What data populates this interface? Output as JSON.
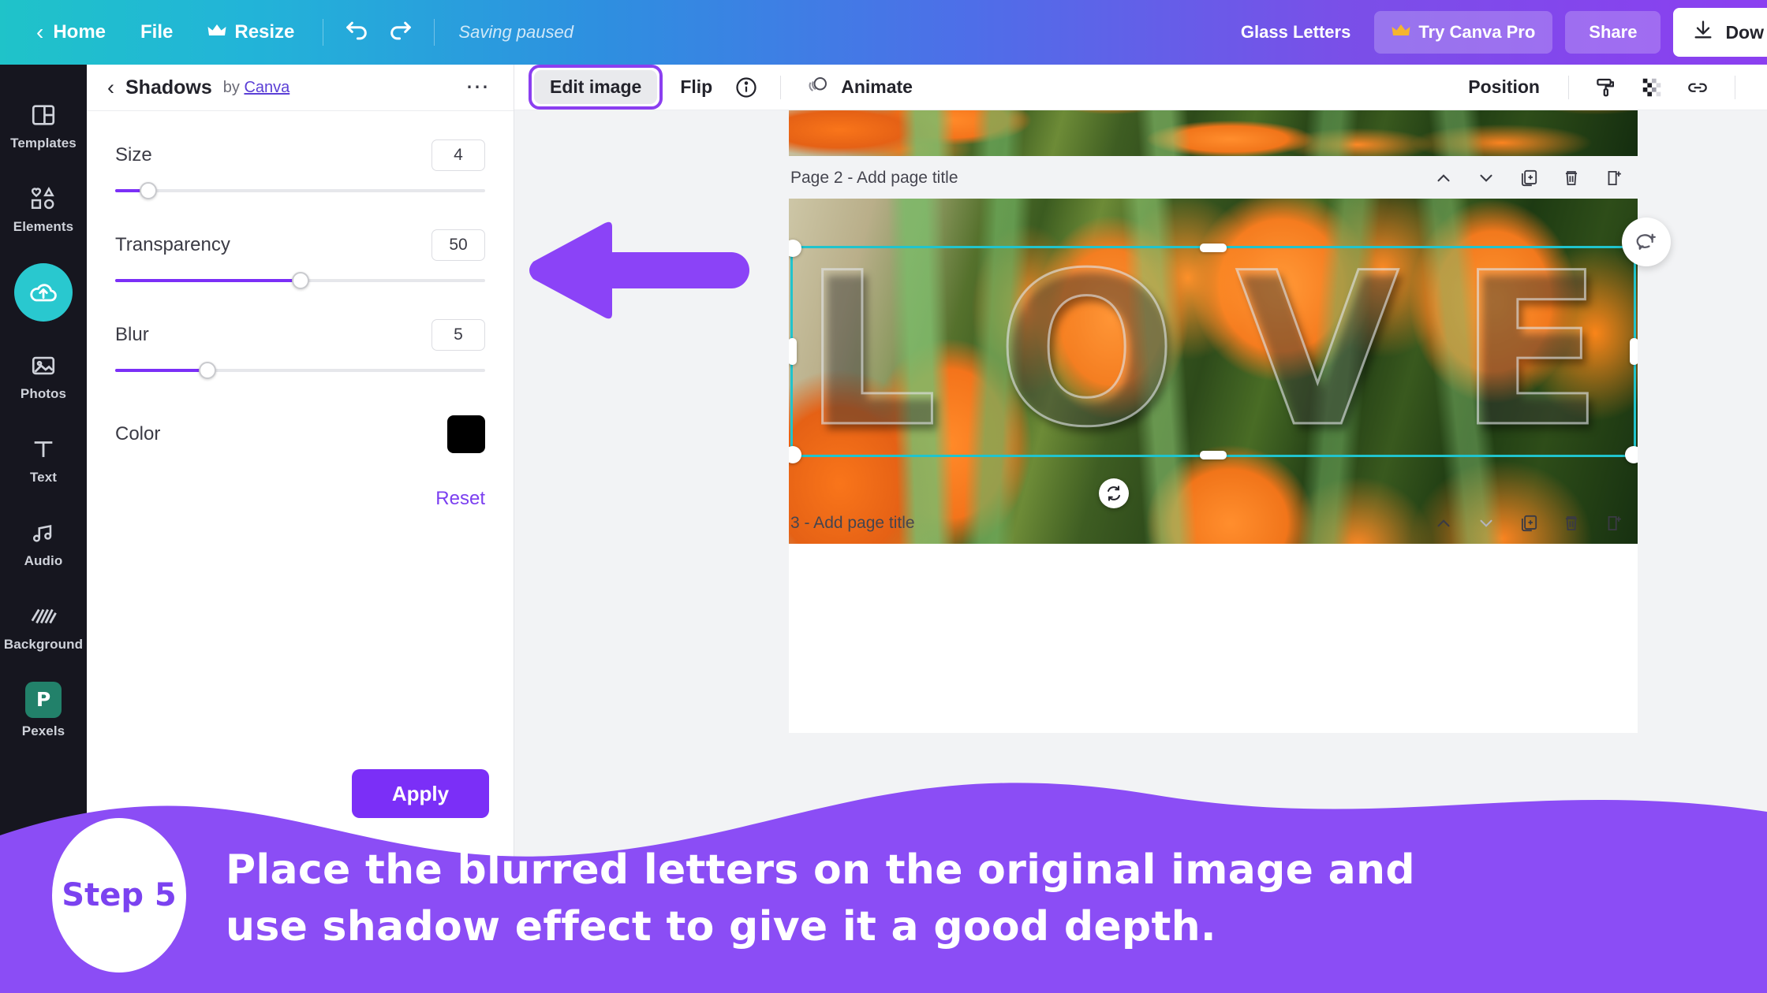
{
  "topbar": {
    "back_icon": "chevron-left-icon",
    "home": "Home",
    "file": "File",
    "resize": "Resize",
    "resize_icon": "crown-icon",
    "undo_icon": "undo-icon",
    "redo_icon": "redo-icon",
    "status": "Saving paused",
    "doc_title": "Glass Letters",
    "try_pro": "Try Canva Pro",
    "try_pro_icon": "crown-icon",
    "share": "Share",
    "download": "Dow",
    "download_icon": "download-icon",
    "gradient_start": "#1fc3c9",
    "gradient_end": "#8b3ff0"
  },
  "rail": {
    "items": [
      {
        "label": "Templates",
        "icon": "templates-icon",
        "active": false
      },
      {
        "label": "Elements",
        "icon": "elements-icon",
        "active": false
      },
      {
        "label": "",
        "icon": "uploads-cloud-icon",
        "active": true
      },
      {
        "label": "Photos",
        "icon": "photos-icon",
        "active": false
      },
      {
        "label": "Text",
        "icon": "text-icon",
        "active": false
      },
      {
        "label": "Audio",
        "icon": "audio-icon",
        "active": false
      },
      {
        "label": "Background",
        "icon": "background-icon",
        "active": false
      },
      {
        "label": "Pexels",
        "icon": "pexels-icon",
        "active": false
      }
    ],
    "active_color": "#29c8cf",
    "pexels_letter": "P"
  },
  "panel": {
    "back_icon": "chevron-left-icon",
    "title": "Shadows",
    "by_prefix": "by",
    "by_link": "Canva",
    "more_icon": "more-dots-icon",
    "controls": [
      {
        "label": "Size",
        "value": "4",
        "percent": 9
      },
      {
        "label": "Transparency",
        "value": "50",
        "percent": 50
      },
      {
        "label": "Blur",
        "value": "5",
        "percent": 25
      }
    ],
    "color_label": "Color",
    "color_value": "#000000",
    "reset": "Reset",
    "apply": "Apply",
    "accent": "#7b2ff7"
  },
  "toolbar": {
    "edit_image": "Edit image",
    "flip": "Flip",
    "info_icon": "info-icon",
    "animate": "Animate",
    "animate_icon": "animate-icon",
    "position": "Position",
    "copy_style_icon": "paint-roller-icon",
    "transparency_icon": "transparency-checker-icon",
    "link_icon": "link-icon",
    "highlight_color": "#8b3ff0"
  },
  "canvas": {
    "page1": {
      "title": ""
    },
    "page2": {
      "title": "Page 2 - Add page title",
      "up_icon": "chevron-up-icon",
      "down_icon": "chevron-down-icon",
      "duplicate_icon": "duplicate-page-icon",
      "delete_icon": "trash-icon",
      "add_icon": "add-page-icon"
    },
    "page3": {
      "title": "3 - Add page title",
      "up_icon": "chevron-up-icon",
      "down_icon": "chevron-down-icon",
      "duplicate_icon": "duplicate-page-icon",
      "delete_icon": "trash-icon",
      "add_icon": "add-page-icon"
    },
    "artwork_letters": [
      "L",
      "O",
      "V",
      "E"
    ],
    "selection_color": "#20c4cd",
    "rotate_icon": "rotate-icon",
    "comment_icon": "add-comment-icon"
  },
  "annotation": {
    "arrow_icon": "arrow-left-icon",
    "arrow_color": "#8b43f7",
    "step_badge": "Step 5",
    "caption_line1": "Place the blurred letters on the original image and",
    "caption_line2": "use shadow effect to give it a good depth.",
    "overlay_color": "#8b4df5"
  }
}
